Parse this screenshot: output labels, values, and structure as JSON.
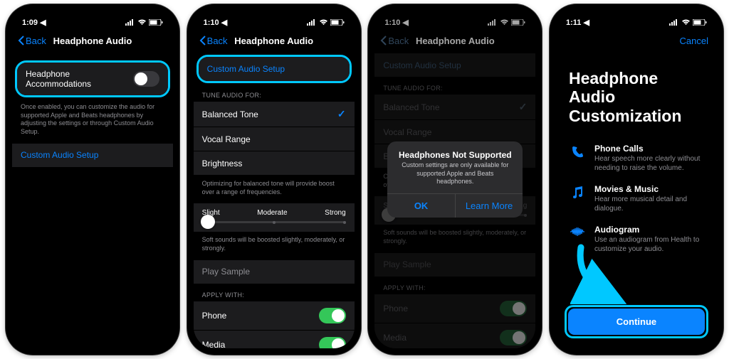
{
  "status": {
    "times": [
      "1:09",
      "1:10",
      "1:10",
      "1:11"
    ],
    "am_indicator": "◀"
  },
  "nav": {
    "back": "Back",
    "title": "Headphone Audio",
    "cancel": "Cancel"
  },
  "p1": {
    "toggle_label": "Headphone Accommodations",
    "desc": "Once enabled, you can customize the audio for supported Apple and Beats headphones by adjusting the settings or through Custom Audio Setup.",
    "custom": "Custom Audio Setup"
  },
  "p2": {
    "custom": "Custom Audio Setup",
    "tune_header": "TUNE AUDIO FOR:",
    "opt1": "Balanced Tone",
    "opt2": "Vocal Range",
    "opt3": "Brightness",
    "tune_desc": "Optimizing for balanced tone will provide boost over a range of frequencies.",
    "slider": {
      "l": "Slight",
      "m": "Moderate",
      "r": "Strong"
    },
    "boost_desc": "Soft sounds will be boosted slightly, moderately, or strongly.",
    "play": "Play Sample",
    "apply_header": "APPLY WITH:",
    "phone": "Phone",
    "media": "Media"
  },
  "alert": {
    "title": "Headphones Not Supported",
    "msg": "Custom settings are only available for supported Apple and Beats headphones.",
    "ok": "OK",
    "learn": "Learn More"
  },
  "p4": {
    "title": "Headphone Audio Customization",
    "f1t": "Phone Calls",
    "f1d": "Hear speech more clearly without needing to raise the volume.",
    "f2t": "Movies & Music",
    "f2d": "Hear more musical detail and dialogue.",
    "f3t": "Audiogram",
    "f3d": "Use an audiogram from Health to customize your audio.",
    "continue": "Continue"
  }
}
